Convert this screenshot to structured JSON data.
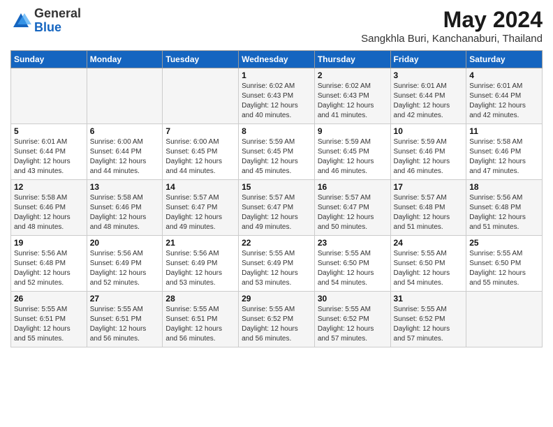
{
  "logo": {
    "general": "General",
    "blue": "Blue"
  },
  "title": "May 2024",
  "location": "Sangkhla Buri, Kanchanaburi, Thailand",
  "headers": [
    "Sunday",
    "Monday",
    "Tuesday",
    "Wednesday",
    "Thursday",
    "Friday",
    "Saturday"
  ],
  "weeks": [
    [
      {
        "day": "",
        "info": ""
      },
      {
        "day": "",
        "info": ""
      },
      {
        "day": "",
        "info": ""
      },
      {
        "day": "1",
        "info": "Sunrise: 6:02 AM\nSunset: 6:43 PM\nDaylight: 12 hours\nand 40 minutes."
      },
      {
        "day": "2",
        "info": "Sunrise: 6:02 AM\nSunset: 6:43 PM\nDaylight: 12 hours\nand 41 minutes."
      },
      {
        "day": "3",
        "info": "Sunrise: 6:01 AM\nSunset: 6:44 PM\nDaylight: 12 hours\nand 42 minutes."
      },
      {
        "day": "4",
        "info": "Sunrise: 6:01 AM\nSunset: 6:44 PM\nDaylight: 12 hours\nand 42 minutes."
      }
    ],
    [
      {
        "day": "5",
        "info": "Sunrise: 6:01 AM\nSunset: 6:44 PM\nDaylight: 12 hours\nand 43 minutes."
      },
      {
        "day": "6",
        "info": "Sunrise: 6:00 AM\nSunset: 6:44 PM\nDaylight: 12 hours\nand 44 minutes."
      },
      {
        "day": "7",
        "info": "Sunrise: 6:00 AM\nSunset: 6:45 PM\nDaylight: 12 hours\nand 44 minutes."
      },
      {
        "day": "8",
        "info": "Sunrise: 5:59 AM\nSunset: 6:45 PM\nDaylight: 12 hours\nand 45 minutes."
      },
      {
        "day": "9",
        "info": "Sunrise: 5:59 AM\nSunset: 6:45 PM\nDaylight: 12 hours\nand 46 minutes."
      },
      {
        "day": "10",
        "info": "Sunrise: 5:59 AM\nSunset: 6:46 PM\nDaylight: 12 hours\nand 46 minutes."
      },
      {
        "day": "11",
        "info": "Sunrise: 5:58 AM\nSunset: 6:46 PM\nDaylight: 12 hours\nand 47 minutes."
      }
    ],
    [
      {
        "day": "12",
        "info": "Sunrise: 5:58 AM\nSunset: 6:46 PM\nDaylight: 12 hours\nand 48 minutes."
      },
      {
        "day": "13",
        "info": "Sunrise: 5:58 AM\nSunset: 6:46 PM\nDaylight: 12 hours\nand 48 minutes."
      },
      {
        "day": "14",
        "info": "Sunrise: 5:57 AM\nSunset: 6:47 PM\nDaylight: 12 hours\nand 49 minutes."
      },
      {
        "day": "15",
        "info": "Sunrise: 5:57 AM\nSunset: 6:47 PM\nDaylight: 12 hours\nand 49 minutes."
      },
      {
        "day": "16",
        "info": "Sunrise: 5:57 AM\nSunset: 6:47 PM\nDaylight: 12 hours\nand 50 minutes."
      },
      {
        "day": "17",
        "info": "Sunrise: 5:57 AM\nSunset: 6:48 PM\nDaylight: 12 hours\nand 51 minutes."
      },
      {
        "day": "18",
        "info": "Sunrise: 5:56 AM\nSunset: 6:48 PM\nDaylight: 12 hours\nand 51 minutes."
      }
    ],
    [
      {
        "day": "19",
        "info": "Sunrise: 5:56 AM\nSunset: 6:48 PM\nDaylight: 12 hours\nand 52 minutes."
      },
      {
        "day": "20",
        "info": "Sunrise: 5:56 AM\nSunset: 6:49 PM\nDaylight: 12 hours\nand 52 minutes."
      },
      {
        "day": "21",
        "info": "Sunrise: 5:56 AM\nSunset: 6:49 PM\nDaylight: 12 hours\nand 53 minutes."
      },
      {
        "day": "22",
        "info": "Sunrise: 5:55 AM\nSunset: 6:49 PM\nDaylight: 12 hours\nand 53 minutes."
      },
      {
        "day": "23",
        "info": "Sunrise: 5:55 AM\nSunset: 6:50 PM\nDaylight: 12 hours\nand 54 minutes."
      },
      {
        "day": "24",
        "info": "Sunrise: 5:55 AM\nSunset: 6:50 PM\nDaylight: 12 hours\nand 54 minutes."
      },
      {
        "day": "25",
        "info": "Sunrise: 5:55 AM\nSunset: 6:50 PM\nDaylight: 12 hours\nand 55 minutes."
      }
    ],
    [
      {
        "day": "26",
        "info": "Sunrise: 5:55 AM\nSunset: 6:51 PM\nDaylight: 12 hours\nand 55 minutes."
      },
      {
        "day": "27",
        "info": "Sunrise: 5:55 AM\nSunset: 6:51 PM\nDaylight: 12 hours\nand 56 minutes."
      },
      {
        "day": "28",
        "info": "Sunrise: 5:55 AM\nSunset: 6:51 PM\nDaylight: 12 hours\nand 56 minutes."
      },
      {
        "day": "29",
        "info": "Sunrise: 5:55 AM\nSunset: 6:52 PM\nDaylight: 12 hours\nand 56 minutes."
      },
      {
        "day": "30",
        "info": "Sunrise: 5:55 AM\nSunset: 6:52 PM\nDaylight: 12 hours\nand 57 minutes."
      },
      {
        "day": "31",
        "info": "Sunrise: 5:55 AM\nSunset: 6:52 PM\nDaylight: 12 hours\nand 57 minutes."
      },
      {
        "day": "",
        "info": ""
      }
    ]
  ]
}
